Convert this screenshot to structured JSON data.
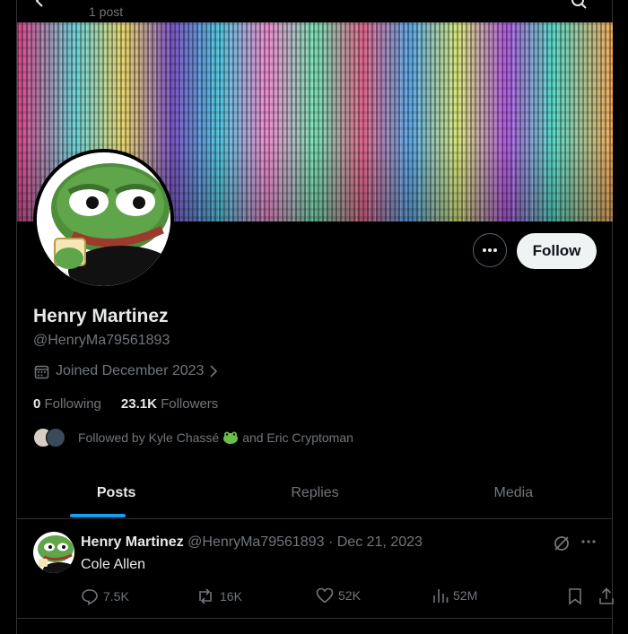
{
  "header": {
    "post_count": "1 post"
  },
  "profile": {
    "display_name": "Henry Martinez",
    "handle": "@HenryMa79561893",
    "joined": "Joined December 2023",
    "following_count": "0",
    "following_label": "Following",
    "followers_count": "23.1K",
    "followers_label": "Followers",
    "followed_by_prefix": "Followed by Kyle Chassé",
    "followed_by_suffix": "and Eric Cryptoman",
    "follow_label": "Follow"
  },
  "tabs": [
    {
      "label": "Posts",
      "active": true
    },
    {
      "label": "Replies",
      "active": false
    },
    {
      "label": "Media",
      "active": false
    }
  ],
  "tweet": {
    "name": "Henry Martinez",
    "handle": "@HenryMa79561893",
    "separator": "·",
    "date": "Dec 21, 2023",
    "text": "Cole Allen",
    "replies": "7.5K",
    "reposts": "16K",
    "likes": "52K",
    "views": "52M"
  },
  "colors": {
    "accent": "#1d9bf0",
    "background": "#000000",
    "muted": "#71767b",
    "text": "#e7e9ea"
  },
  "icons": [
    "back-arrow-icon",
    "search-icon",
    "more-icon",
    "calendar-icon",
    "chevron-right-icon",
    "frog-emoji-icon",
    "grok-icon",
    "reply-icon",
    "repost-icon",
    "like-icon",
    "views-icon",
    "bookmark-icon",
    "share-icon"
  ]
}
